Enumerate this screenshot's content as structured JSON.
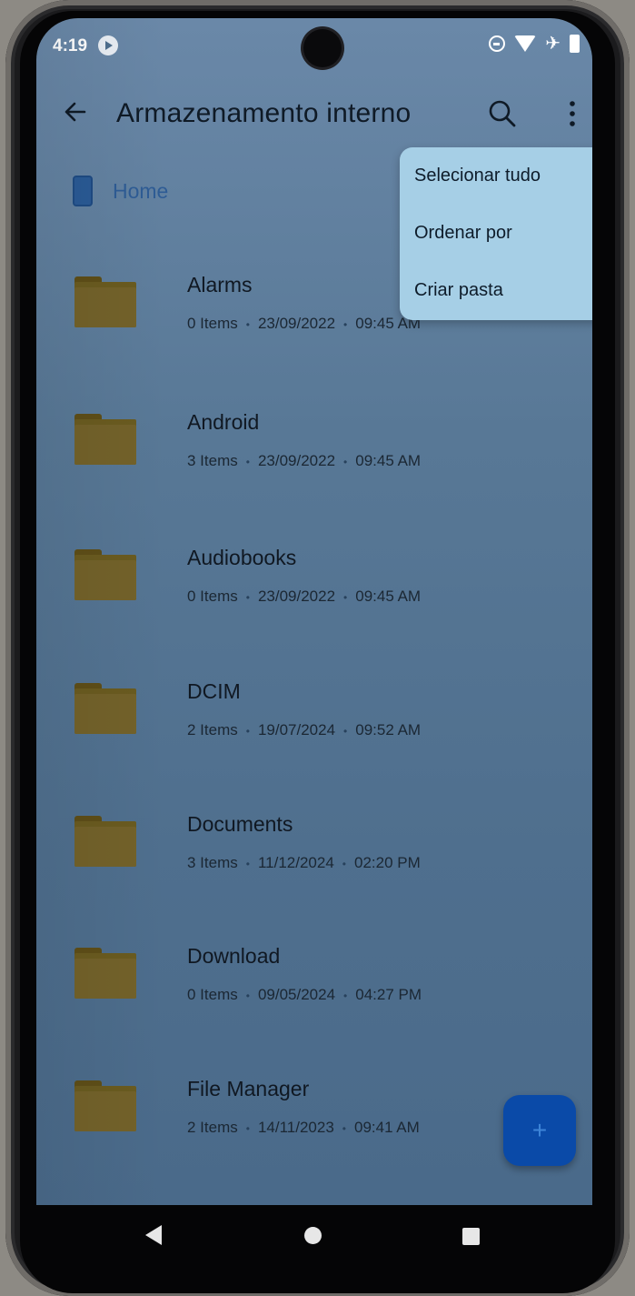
{
  "status_bar": {
    "time": "4:19",
    "icons": [
      "media-notification-icon",
      "do-not-disturb-icon",
      "wifi-icon",
      "airplane-icon",
      "battery-icon"
    ]
  },
  "app_bar": {
    "title": "Armazenamento interno",
    "icons": [
      "back-icon",
      "search-icon",
      "more-vert-icon"
    ]
  },
  "breadcrumb": {
    "label": "Home",
    "icon": "phone-storage-icon"
  },
  "menu": {
    "items": [
      {
        "label": "Selecionar tudo"
      },
      {
        "label": "Ordenar por"
      },
      {
        "label": "Criar pasta"
      }
    ]
  },
  "folders": [
    {
      "name": "Alarms",
      "count": "0 Items",
      "date": "23/09/2022",
      "time": "09:45 AM"
    },
    {
      "name": "Android",
      "count": "3 Items",
      "date": "23/09/2022",
      "time": "09:45 AM"
    },
    {
      "name": "Audiobooks",
      "count": "0 Items",
      "date": "23/09/2022",
      "time": "09:45 AM"
    },
    {
      "name": "DCIM",
      "count": "2 Items",
      "date": "19/07/2024",
      "time": "09:52 AM"
    },
    {
      "name": "Documents",
      "count": "3 Items",
      "date": "11/12/2024",
      "time": "02:20 PM"
    },
    {
      "name": "Download",
      "count": "0 Items",
      "date": "09/05/2024",
      "time": "04:27 PM"
    },
    {
      "name": "File Manager",
      "count": "2 Items",
      "date": "14/11/2023",
      "time": "09:41 AM"
    }
  ],
  "fab": {
    "label": "+"
  },
  "colors": {
    "screen_bg": "#587896",
    "menu_bg": "#a6cfe6",
    "folder": "#6a5b20",
    "fab": "#0a4aa8",
    "breadcrumb": "#2e5c95"
  }
}
